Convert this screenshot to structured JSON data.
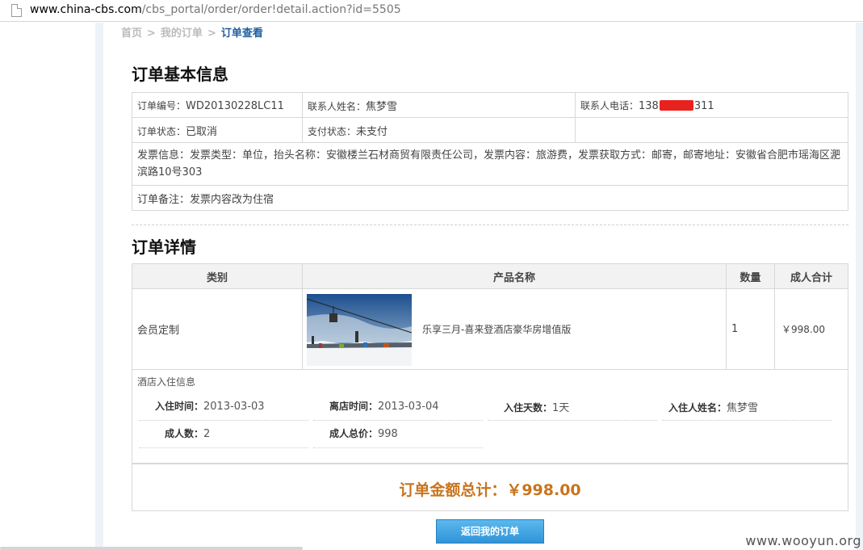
{
  "browser": {
    "url_host": "www.china-cbs.com",
    "url_path": "/cbs_portal/order/order!detail.action?id=5505"
  },
  "breadcrumb": {
    "home": "首页",
    "separator": ">",
    "my_orders": "我的订单",
    "current": "订单查看"
  },
  "basic_info": {
    "title": "订单基本信息",
    "order_no_label": "订单编号：",
    "order_no": "WD20130228LC11",
    "contact_name_label": "联系人姓名：",
    "contact_name": "焦梦雪",
    "contact_phone_label": "联系人电话：",
    "contact_phone_prefix": "138",
    "contact_phone_suffix": "311",
    "order_status_label": "订单状态：",
    "order_status": "已取消",
    "pay_status_label": "支付状态：",
    "pay_status": "未支付",
    "invoice_info": "发票信息：发票类型：单位，抬头名称：安徽楼兰石材商贸有限责任公司，发票内容：旅游费，发票获取方式：邮寄，邮寄地址：安徽省合肥市瑶海区淝滨路10号303",
    "remark": "订单备注：发票内容改为住宿"
  },
  "detail": {
    "title": "订单详情",
    "headers": [
      "类别",
      "产品名称",
      "数量",
      "成人合计"
    ],
    "row": {
      "category": "会员定制",
      "product_name": "乐享三月-喜来登酒店豪华房增值版",
      "quantity": "1",
      "adult_total": "￥998.00"
    },
    "hotel": {
      "title": "酒店入住信息",
      "checkin_label": "入住时间：",
      "checkin": "2013-03-03",
      "checkout_label": "离店时间：",
      "checkout": "2013-03-04",
      "days_label": "入住天数：",
      "days": "1天",
      "guest_label": "入住人姓名：",
      "guest": "焦梦雪",
      "adults_label": "成人数：",
      "adults": "2",
      "adult_price_label": "成人总价：",
      "adult_price": "998"
    },
    "total_text": "订单金额总计：￥998.00"
  },
  "back_button": "返回我的订单",
  "watermark": "www.wooyun.org"
}
